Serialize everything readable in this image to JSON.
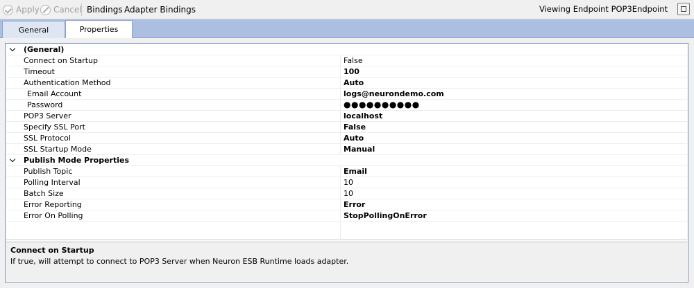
{
  "toolbar": {
    "apply_label": "Apply",
    "cancel_label": "Cancel",
    "bindings_label": "Bindings",
    "adapter_bindings_label": "Adapter Bindings",
    "viewing_text": "Viewing Endpoint POP3Endpoint"
  },
  "tabs": {
    "general": "General",
    "properties": "Properties"
  },
  "grid": {
    "cat_general": "(General)",
    "connect_on_startup": {
      "label": "Connect on Startup",
      "value": "False"
    },
    "timeout": {
      "label": "Timeout",
      "value": "100"
    },
    "authentication_method": {
      "label": "Authentication Method",
      "value": "Auto"
    },
    "email_account": {
      "label": "Email Account",
      "value": "logs@neurondemo.com"
    },
    "password": {
      "label": "Password",
      "value": "●●●●●●●●●●"
    },
    "pop3_server": {
      "label": "POP3 Server",
      "value": "localhost"
    },
    "specify_ssl_port": {
      "label": "Specify SSL Port",
      "value": "False"
    },
    "ssl_protocol": {
      "label": "SSL Protocol",
      "value": "Auto"
    },
    "ssl_startup_mode": {
      "label": "SSL Startup Mode",
      "value": "Manual"
    },
    "cat_publish": "Publish Mode Properties",
    "publish_topic": {
      "label": "Publish Topic",
      "value": "Email"
    },
    "polling_interval": {
      "label": "Polling Interval",
      "value": "10"
    },
    "batch_size": {
      "label": "Batch Size",
      "value": "10"
    },
    "error_reporting": {
      "label": "Error Reporting",
      "value": "Error"
    },
    "error_on_polling": {
      "label": "Error On Polling",
      "value": "StopPollingOnError"
    }
  },
  "description": {
    "title": "Connect on Startup",
    "text": "If true, will attempt to connect to POP3 Server when Neuron ESB Runtime loads adapter."
  }
}
